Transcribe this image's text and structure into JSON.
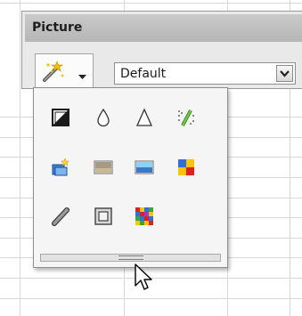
{
  "toolbar": {
    "title": "Picture",
    "filter_button_icon": "magic-wand-icon",
    "dropdown_arrow_icon": "triangle-down-icon",
    "graphics_mode": {
      "value": "Default",
      "dropdown_icon": "chevron-down-icon"
    }
  },
  "filter_popup": {
    "rows": [
      [
        "invert-icon",
        "smooth-icon",
        "sharpen-icon",
        "remove-noise-icon"
      ],
      [
        "solarization-icon",
        "aging-icon",
        "posterize-icon",
        "pop-art-icon"
      ],
      [
        "charcoal-sketch-icon",
        "relief-icon",
        "mosaic-icon"
      ]
    ],
    "resize_grip_icon": "grip-handle-icon"
  },
  "cursor_icon": "mouse-pointer-icon"
}
